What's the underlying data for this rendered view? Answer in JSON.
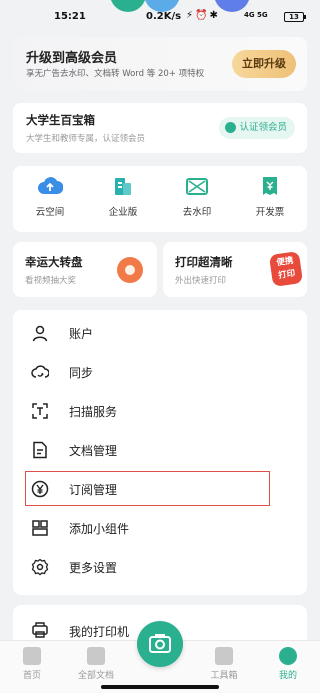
{
  "status_bar": {
    "time": "15:21",
    "speed": "0.2K/s",
    "signal": "4G 5G",
    "battery": "13"
  },
  "vip_banner": {
    "title": "升级到高级会员",
    "subtitle": "享无广告去水印、文档转 Word 等 20+ 项特权",
    "button": "立即升级"
  },
  "edu_card": {
    "title": "大学生百宝箱",
    "subtitle": "大学生和教师专属，认证领会员",
    "button": "认证领会员"
  },
  "quick_tools": [
    {
      "label": "云空间",
      "icon": "cloud-upload-icon",
      "color": "#3a8ee6"
    },
    {
      "label": "企业版",
      "icon": "building-icon",
      "color": "#2bb0b0"
    },
    {
      "label": "去水印",
      "icon": "remove-watermark-icon",
      "color": "#2bb08f"
    },
    {
      "label": "开发票",
      "icon": "invoice-icon",
      "color": "#2bb08f"
    }
  ],
  "promos": [
    {
      "title": "幸运大转盘",
      "subtitle": "看视频抽大奖",
      "icon": "lucky-wheel-icon"
    },
    {
      "title": "打印超清晰",
      "subtitle": "外出快速打印",
      "badge": "便携\n打印"
    }
  ],
  "menu": [
    {
      "label": "账户",
      "icon": "user-icon"
    },
    {
      "label": "同步",
      "icon": "cloud-sync-icon"
    },
    {
      "label": "扫描服务",
      "icon": "scan-text-icon"
    },
    {
      "label": "文档管理",
      "icon": "document-icon"
    },
    {
      "label": "订阅管理",
      "icon": "yen-circle-icon"
    },
    {
      "label": "添加小组件",
      "icon": "widget-icon"
    },
    {
      "label": "更多设置",
      "icon": "gear-icon"
    }
  ],
  "printer": {
    "label": "我的打印机",
    "icon": "printer-icon"
  },
  "bottom_nav": [
    {
      "label": "首页",
      "icon": "home-icon"
    },
    {
      "label": "全部文档",
      "icon": "folder-icon"
    },
    {
      "label": "工具箱",
      "icon": "toolbox-icon"
    },
    {
      "label": "我的",
      "icon": "profile-icon",
      "active": true
    }
  ],
  "colors": {
    "accent": "#2bb08f",
    "vip_gold": "#eec178",
    "highlight": "#e0504a"
  }
}
